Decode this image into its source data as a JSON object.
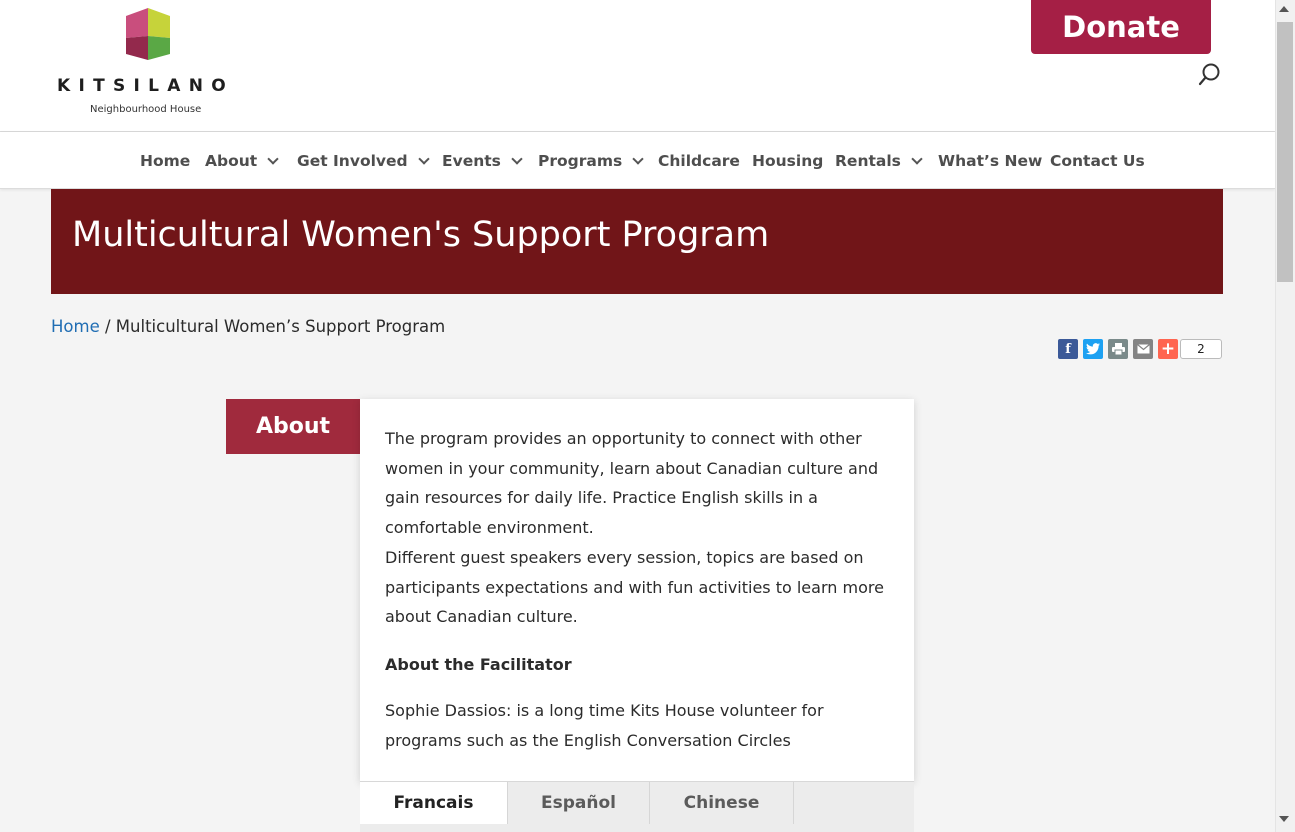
{
  "logo": {
    "word": "KITSILANO",
    "subtitle": "Neighbourhood House",
    "colors": [
      "#c6d33a",
      "#5aa845",
      "#c94e7d",
      "#93294c"
    ]
  },
  "header": {
    "donate_label": "Donate",
    "search_icon": "search-icon"
  },
  "nav": {
    "items": [
      {
        "label": "Home",
        "has_dropdown": false
      },
      {
        "label": "About",
        "has_dropdown": true
      },
      {
        "label": "Get Involved",
        "has_dropdown": true
      },
      {
        "label": "Events",
        "has_dropdown": true
      },
      {
        "label": "Programs",
        "has_dropdown": true
      },
      {
        "label": "Childcare",
        "has_dropdown": false
      },
      {
        "label": "Housing",
        "has_dropdown": false
      },
      {
        "label": "Rentals",
        "has_dropdown": true
      },
      {
        "label": "What’s New",
        "has_dropdown": false
      },
      {
        "label": "Contact Us",
        "has_dropdown": false
      }
    ]
  },
  "banner": {
    "title": "Multicultural Women's Support Program",
    "color": "#711518"
  },
  "breadcrumb": {
    "home": "Home",
    "separator": " / ",
    "current": "Multicultural Women’s Support Program"
  },
  "share": {
    "buttons": [
      {
        "name": "facebook-icon",
        "glyph": "f",
        "color": "#3b5998"
      },
      {
        "name": "twitter-icon",
        "glyph": "t",
        "color": "#1da1f2"
      },
      {
        "name": "print-icon",
        "glyph": "⎙",
        "color": "#7a8a8a"
      },
      {
        "name": "email-icon",
        "glyph": "✉",
        "color": "#848484"
      },
      {
        "name": "more-icon",
        "glyph": "+",
        "color": "#ff6550"
      }
    ],
    "count": "2"
  },
  "about": {
    "tab_label": "About",
    "tab_color": "#a02a3d",
    "paragraph1_lines": [
      "The program provides an opportunity to connect with other",
      "women in your community, learn about Canadian culture and",
      "gain resources for daily life. Practice English skills in a",
      "comfortable environment."
    ],
    "paragraph2_lines": [
      "Different guest speakers every session, topics are based on",
      "participants expectations and with fun activities to learn more",
      "about Canadian culture."
    ],
    "facilitator_heading": "About the Facilitator",
    "facilitator_lines": [
      "Sophie Dassios: is a long time Kits House volunteer for",
      "programs such as the English Conversation Circles"
    ]
  },
  "language_tabs": {
    "items": [
      "Francais",
      "Español",
      "Chinese"
    ],
    "active": "Francais"
  }
}
